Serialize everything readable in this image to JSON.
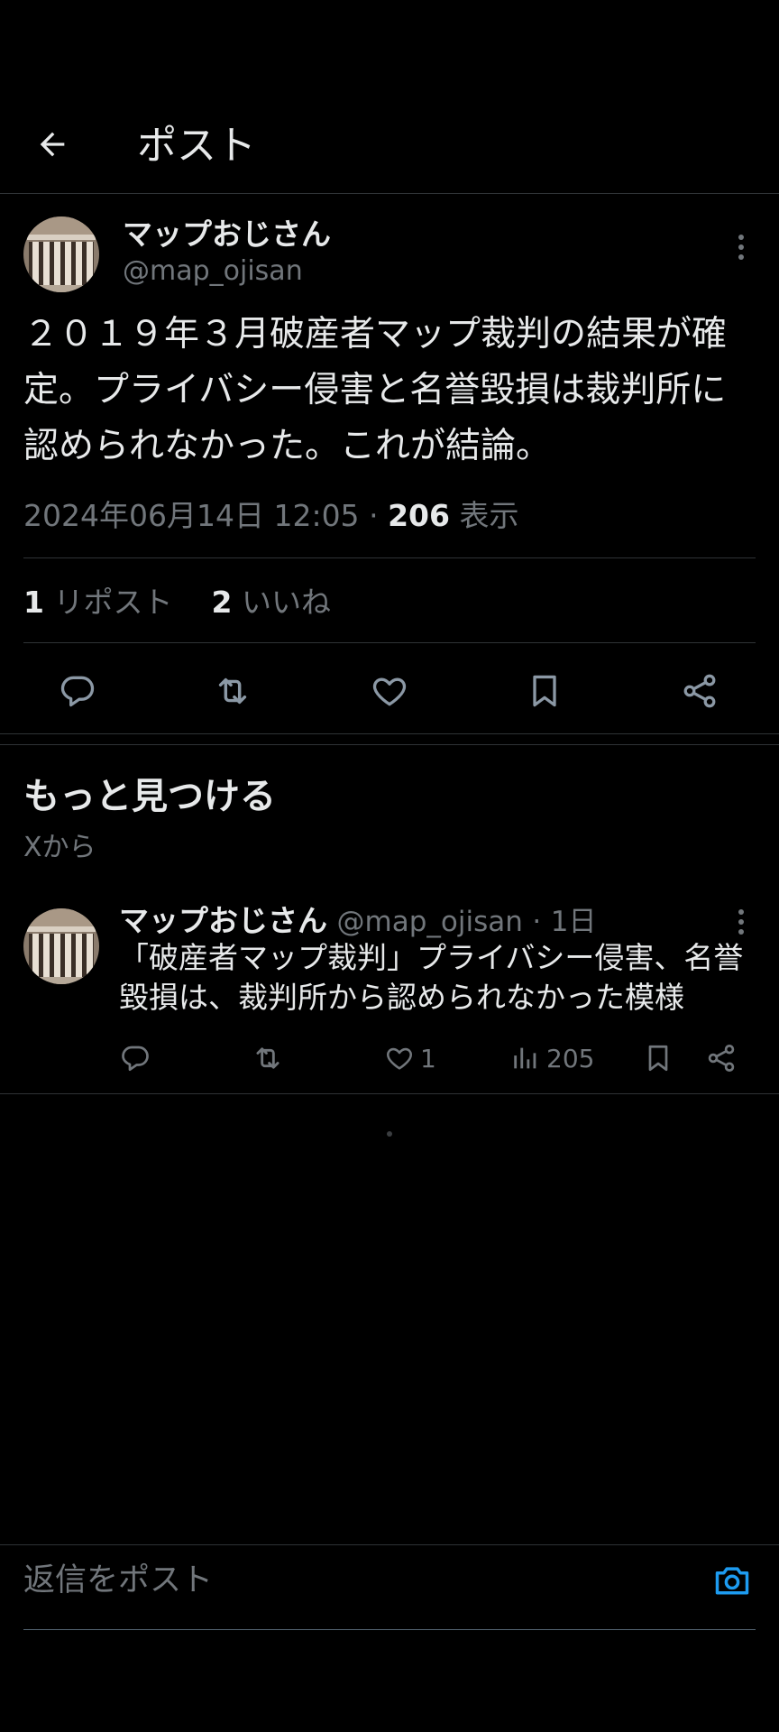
{
  "header": {
    "title": "ポスト"
  },
  "post": {
    "author_name": "マップおじさん",
    "author_handle": "@map_ojisan",
    "text": "２０１９年３月破産者マップ裁判の結果が確定。プライバシー侵害と名誉毀損は裁判所に認められなかった。これが結論。",
    "timestamp": "2024年06月14日 12:05",
    "separator": "·",
    "views": "206",
    "views_label": "表示",
    "reposts": "1",
    "reposts_label": "リポスト",
    "likes": "2",
    "likes_label": "いいね"
  },
  "discover": {
    "title": "もっと見つける",
    "subtitle": "Xから"
  },
  "recommended": {
    "author_name": "マップおじさん",
    "author_handle": "@map_ojisan",
    "separator": "·",
    "time": "1日",
    "text": "「破産者マップ裁判」プライバシー侵害、名誉毀損は、裁判所から認められなかった模様",
    "likes": "1",
    "views": "205"
  },
  "reply": {
    "placeholder": "返信をポスト"
  },
  "colors": {
    "background": "#000000",
    "text_primary": "#e7e9ea",
    "text_secondary": "#71767b",
    "divider": "#2f3336",
    "accent": "#1d9bf0"
  },
  "icons": [
    "back-arrow-icon",
    "more-vertical-icon",
    "reply-icon",
    "repost-icon",
    "like-icon",
    "bookmark-icon",
    "share-icon",
    "views-icon",
    "camera-icon"
  ]
}
